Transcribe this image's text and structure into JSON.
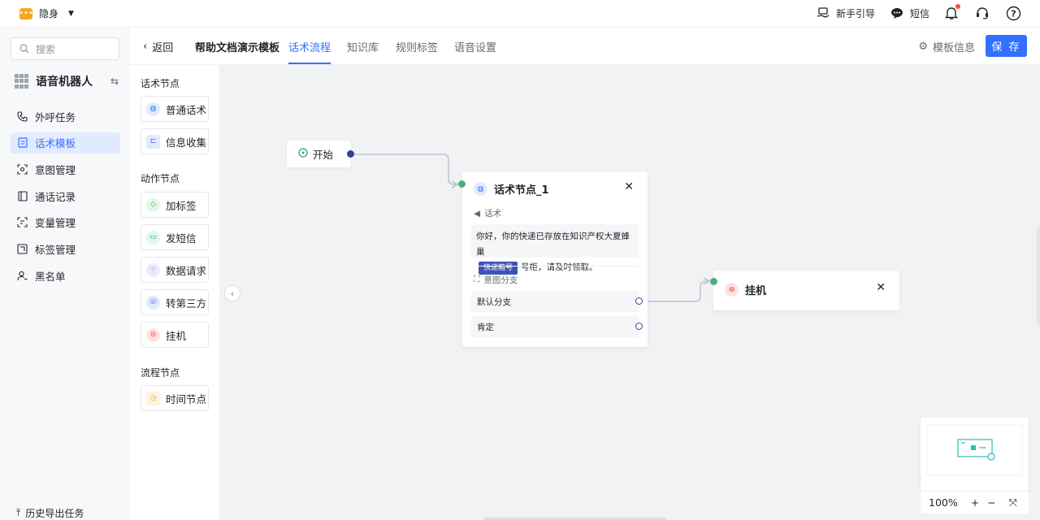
{
  "topbar": {
    "status_label": "隐身",
    "guide_label": "新手引导",
    "sms_label": "短信"
  },
  "sidebar": {
    "search_placeholder": "搜索",
    "app_name": "语音机器人",
    "items": [
      {
        "label": "外呼任务"
      },
      {
        "label": "话术模板"
      },
      {
        "label": "意图管理"
      },
      {
        "label": "通话记录"
      },
      {
        "label": "变量管理"
      },
      {
        "label": "标签管理"
      },
      {
        "label": "黑名单"
      }
    ],
    "history_label": "历史导出任务"
  },
  "header": {
    "back_label": "返回",
    "template_name": "帮助文档演示模板",
    "tabs": [
      {
        "label": "话术流程"
      },
      {
        "label": "知识库"
      },
      {
        "label": "规则标签"
      },
      {
        "label": "语音设置"
      }
    ],
    "template_info_label": "模板信息",
    "save_label": "保 存"
  },
  "palette": {
    "sections": [
      {
        "title": "话术节点",
        "items": [
          "普通话术",
          "信息收集"
        ]
      },
      {
        "title": "动作节点",
        "items": [
          "加标签",
          "发短信",
          "数据请求",
          "转第三方",
          "挂机"
        ]
      },
      {
        "title": "流程节点",
        "items": [
          "时间节点"
        ]
      }
    ]
  },
  "canvas": {
    "start_label": "开始",
    "node1": {
      "title": "话术节点_1",
      "speech_section": "话术",
      "speech_prefix": "你好，你的快递已存放在知识产权大夏蜂巢",
      "variable_chip": "快递箱号",
      "speech_suffix": "号柜，请及时领取。",
      "intent_section": "意图分支",
      "branches": [
        "默认分支",
        "肯定"
      ]
    },
    "node2": {
      "title": "挂机"
    },
    "zoom": "100%"
  },
  "colors": {
    "accent": "#3370ff",
    "port_start": "#2f3fa0",
    "port_in": "#4caf7a",
    "variable_chip": "#3f51b5"
  }
}
